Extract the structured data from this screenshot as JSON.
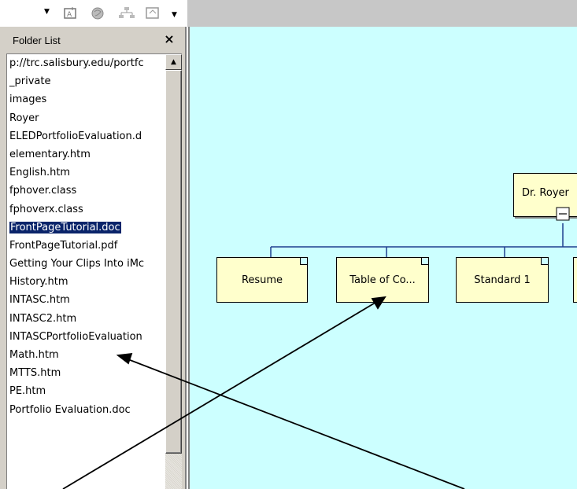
{
  "toolbar": {
    "icons": [
      "dropdown-arrow-icon",
      "insert-image-icon",
      "publish-icon",
      "navigation-icon",
      "table-icon",
      "dropdown-arrow-icon"
    ]
  },
  "folder_panel": {
    "title": "Folder List",
    "close_label": "×",
    "items": [
      "p://trc.salisbury.edu/portfc",
      "_private",
      "images",
      "Royer",
      "ELEDPortfolioEvaluation.d",
      "elementary.htm",
      "English.htm",
      "fphover.class",
      "fphoverx.class",
      "FrontPageTutorial.doc",
      "FrontPageTutorial.pdf",
      "Getting Your Clips Into iMc",
      "History.htm",
      "INTASC.htm",
      "INTASC2.htm",
      "INTASCPortfolioEvaluation",
      "Math.htm",
      "MTTS.htm",
      "PE.htm",
      "Portfolio Evaluation.doc"
    ],
    "selected_index": 9
  },
  "diagram": {
    "root_label": "Dr. Royer",
    "children": [
      "Resume",
      "Table of Co...",
      "Standard 1",
      ""
    ],
    "collapse_symbol": "−"
  },
  "colors": {
    "canvas": "#ccffff",
    "node_fill": "#ffffcc",
    "selection": "#0a246a",
    "panel": "#d4d0c8"
  }
}
